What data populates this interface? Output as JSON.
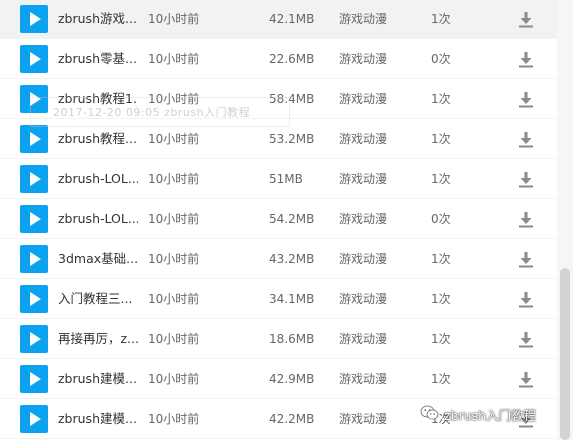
{
  "files": [
    {
      "name": "zbrush游戏...",
      "time": "10小时前",
      "size": "42.1MB",
      "category": "游戏动漫",
      "count": "1次"
    },
    {
      "name": "zbrush零基...",
      "time": "10小时前",
      "size": "22.6MB",
      "category": "游戏动漫",
      "count": "0次"
    },
    {
      "name": "zbrush教程1...",
      "time": "10小时前",
      "size": "58.4MB",
      "category": "游戏动漫",
      "count": "1次"
    },
    {
      "name": "zbrush教程...",
      "time": "10小时前",
      "size": "53.2MB",
      "category": "游戏动漫",
      "count": "1次"
    },
    {
      "name": "zbrush-LOL...",
      "time": "10小时前",
      "size": "51MB",
      "category": "游戏动漫",
      "count": "1次"
    },
    {
      "name": "zbrush-LOL...",
      "time": "10小时前",
      "size": "54.2MB",
      "category": "游戏动漫",
      "count": "0次"
    },
    {
      "name": "3dmax基础...",
      "time": "10小时前",
      "size": "43.2MB",
      "category": "游戏动漫",
      "count": "1次"
    },
    {
      "name": "入门教程三...",
      "time": "10小时前",
      "size": "34.1MB",
      "category": "游戏动漫",
      "count": "1次"
    },
    {
      "name": "再接再厉，z...",
      "time": "10小时前",
      "size": "18.6MB",
      "category": "游戏动漫",
      "count": "1次"
    },
    {
      "name": "zbrush建模...",
      "time": "10小时前",
      "size": "42.9MB",
      "category": "游戏动漫",
      "count": "1次"
    },
    {
      "name": "zbrush建模...",
      "time": "10小时前",
      "size": "42.2MB",
      "category": "游戏动漫",
      "count": "1次"
    }
  ],
  "icons": {
    "play": "play-icon",
    "download": "download-icon",
    "wechat": "wechat-icon"
  },
  "colors": {
    "play_bg": "#0da2f0",
    "download": "#8a8a8a",
    "highlight_row": "#f2f2f2"
  },
  "watermark": {
    "text": "2017-12-20 09:05  zbrush入门教程"
  },
  "badge": {
    "text": "zbrush入门教程"
  }
}
